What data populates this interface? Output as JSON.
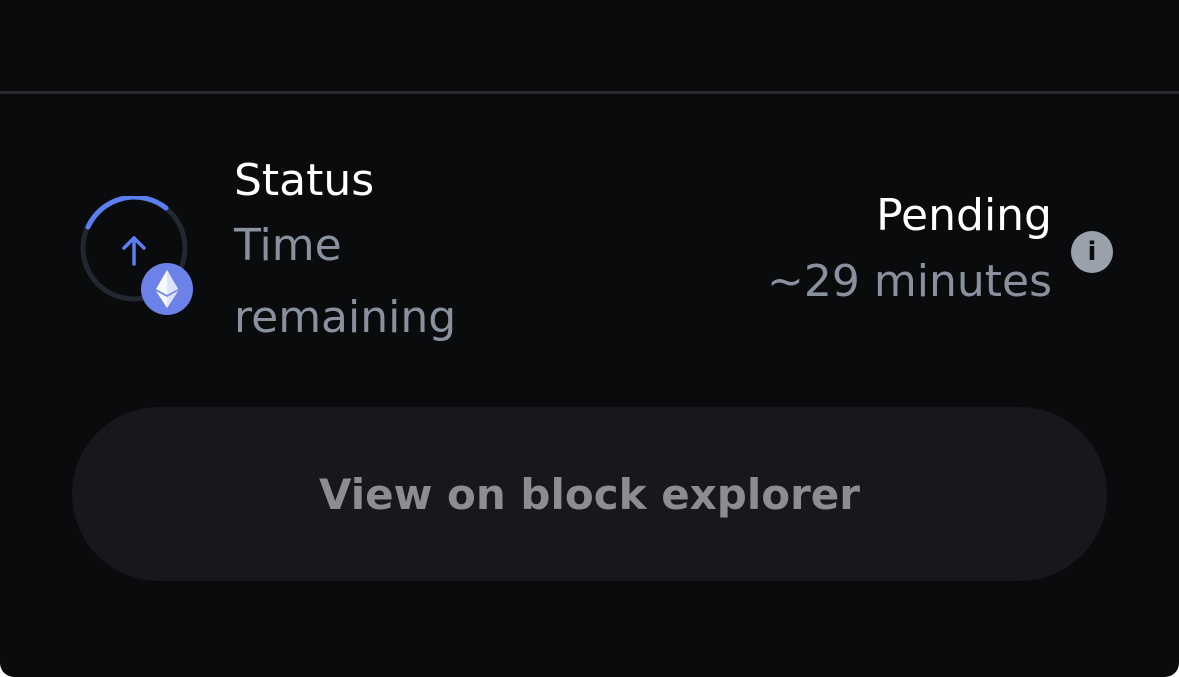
{
  "transaction": {
    "status_label": "Status",
    "time_label": "Time remaining",
    "status_value": "Pending",
    "time_value": "~29 minutes",
    "direction_icon": "arrow-up-icon",
    "network_icon": "ethereum-icon",
    "info_icon": "info-icon",
    "info_glyph": "i"
  },
  "actions": {
    "view_explorer_label": "View on block explorer"
  },
  "colors": {
    "background": "#0a0b0d",
    "accent": "#5b7ff0",
    "eth_badge": "#6c82e8",
    "muted_text": "#8a919e",
    "button_bg": "#17181c",
    "button_text": "#8b8d91"
  }
}
